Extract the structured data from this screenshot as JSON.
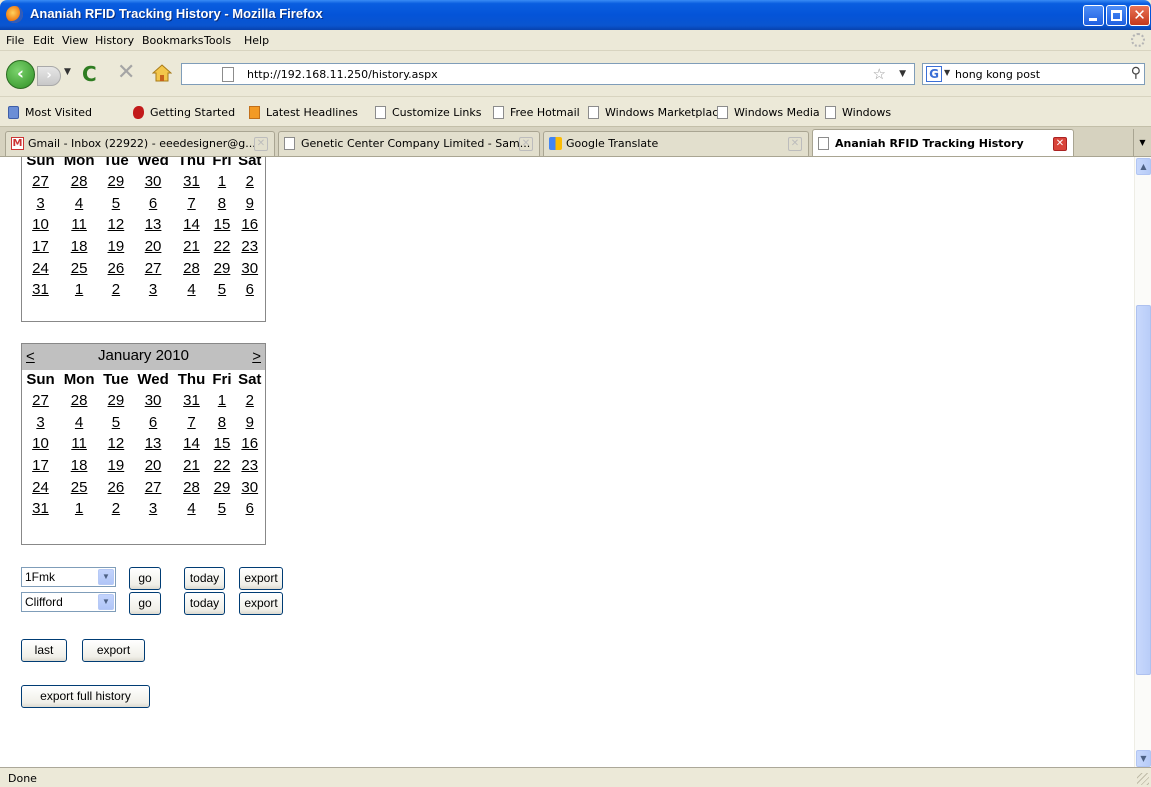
{
  "window": {
    "title": "Ananiah RFID Tracking History - Mozilla Firefox",
    "controls": {
      "minimize": "minimize-icon",
      "maximize": "maximize-icon",
      "close": "close-icon"
    }
  },
  "menu": [
    "File",
    "Edit",
    "View",
    "History",
    "Bookmarks",
    "Tools",
    "Help"
  ],
  "navigation": {
    "url": "http://192.168.11.250/history.aspx",
    "search_value": "hong kong post",
    "search_engine_glyph": "G"
  },
  "bookmarks": [
    "Most Visited",
    "Getting Started",
    "Latest Headlines",
    "Customize Links",
    "Free Hotmail",
    "Windows Marketplace",
    "Windows Media",
    "Windows"
  ],
  "tabs": [
    {
      "label": "Gmail - Inbox (22922) - eeedesigner@g...",
      "icon": "gmail-icon",
      "active": false
    },
    {
      "label": "Genetic Center Company Limited - Sam...",
      "icon": "page-icon",
      "active": false
    },
    {
      "label": "Google Translate",
      "icon": "google-translate-icon",
      "active": false
    },
    {
      "label": "Ananiah RFID Tracking History",
      "icon": "page-icon",
      "active": true
    }
  ],
  "calendar_top": {
    "days": [
      "Sun",
      "Mon",
      "Tue",
      "Wed",
      "Thu",
      "Fri",
      "Sat"
    ],
    "weeks": [
      [
        "27",
        "28",
        "29",
        "30",
        "31",
        "1",
        "2"
      ],
      [
        "3",
        "4",
        "5",
        "6",
        "7",
        "8",
        "9"
      ],
      [
        "10",
        "11",
        "12",
        "13",
        "14",
        "15",
        "16"
      ],
      [
        "17",
        "18",
        "19",
        "20",
        "21",
        "22",
        "23"
      ],
      [
        "24",
        "25",
        "26",
        "27",
        "28",
        "29",
        "30"
      ],
      [
        "31",
        "1",
        "2",
        "3",
        "4",
        "5",
        "6"
      ]
    ]
  },
  "calendar_bottom": {
    "prev": "<",
    "next": ">",
    "title": "January 2010",
    "days": [
      "Sun",
      "Mon",
      "Tue",
      "Wed",
      "Thu",
      "Fri",
      "Sat"
    ],
    "weeks": [
      [
        "27",
        "28",
        "29",
        "30",
        "31",
        "1",
        "2"
      ],
      [
        "3",
        "4",
        "5",
        "6",
        "7",
        "8",
        "9"
      ],
      [
        "10",
        "11",
        "12",
        "13",
        "14",
        "15",
        "16"
      ],
      [
        "17",
        "18",
        "19",
        "20",
        "21",
        "22",
        "23"
      ],
      [
        "24",
        "25",
        "26",
        "27",
        "28",
        "29",
        "30"
      ],
      [
        "31",
        "1",
        "2",
        "3",
        "4",
        "5",
        "6"
      ]
    ]
  },
  "controls": {
    "row1": {
      "select_value": "1Fmk",
      "go": "go",
      "today": "today",
      "export": "export"
    },
    "row2": {
      "select_value": "Clifford",
      "go": "go",
      "today": "today",
      "export": "export"
    },
    "last": "last",
    "last_export": "export",
    "export_full": "export full history"
  },
  "status": "Done"
}
